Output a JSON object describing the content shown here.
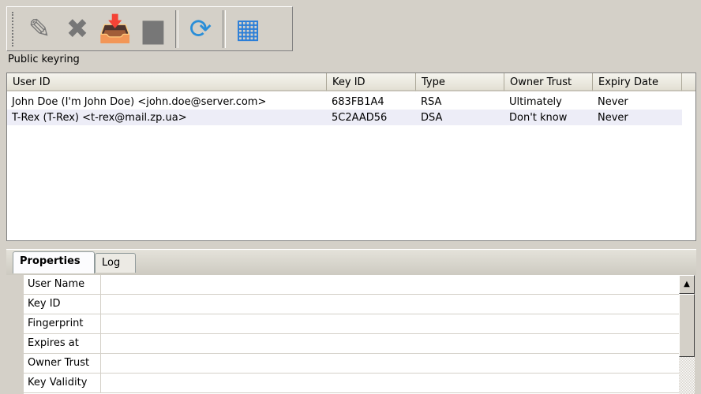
{
  "toolbar": {
    "items": [
      {
        "name": "edit",
        "icon": "pencil-icon",
        "glyph": "✎",
        "color": "#777"
      },
      {
        "name": "delete",
        "icon": "delete-x-icon",
        "glyph": "✖",
        "color": "#777"
      },
      {
        "name": "import",
        "icon": "import-folder-icon",
        "glyph": "📥",
        "color": "#e8b400"
      },
      {
        "name": "export",
        "icon": "export-icon",
        "glyph": "▆",
        "color": "#777"
      },
      {
        "name": "refresh",
        "icon": "refresh-icon",
        "glyph": "⟳",
        "color": "#2a8ed8"
      },
      {
        "name": "keyring-view",
        "icon": "window-icon",
        "glyph": "▦",
        "color": "#2a7ed8"
      }
    ]
  },
  "keyring_label": "Public keyring",
  "columns": [
    "User ID",
    "Key ID",
    "Type",
    "Owner Trust",
    "Expiry Date"
  ],
  "keys": [
    [
      "John Doe (I'm John Doe) <john.doe@server.com>",
      "683FB1A4",
      "RSA",
      "Ultimately",
      "Never"
    ],
    [
      "T-Rex (T-Rex) <t-rex@mail.zp.ua>",
      "5C2AAD56",
      "DSA",
      "Don't know",
      "Never"
    ]
  ],
  "tabs": [
    "Properties",
    "Log"
  ],
  "properties": [
    "User Name",
    "Key ID",
    "Fingerprint",
    "Expires at",
    "Owner Trust",
    "Key Validity"
  ],
  "scroll_up": "▲"
}
